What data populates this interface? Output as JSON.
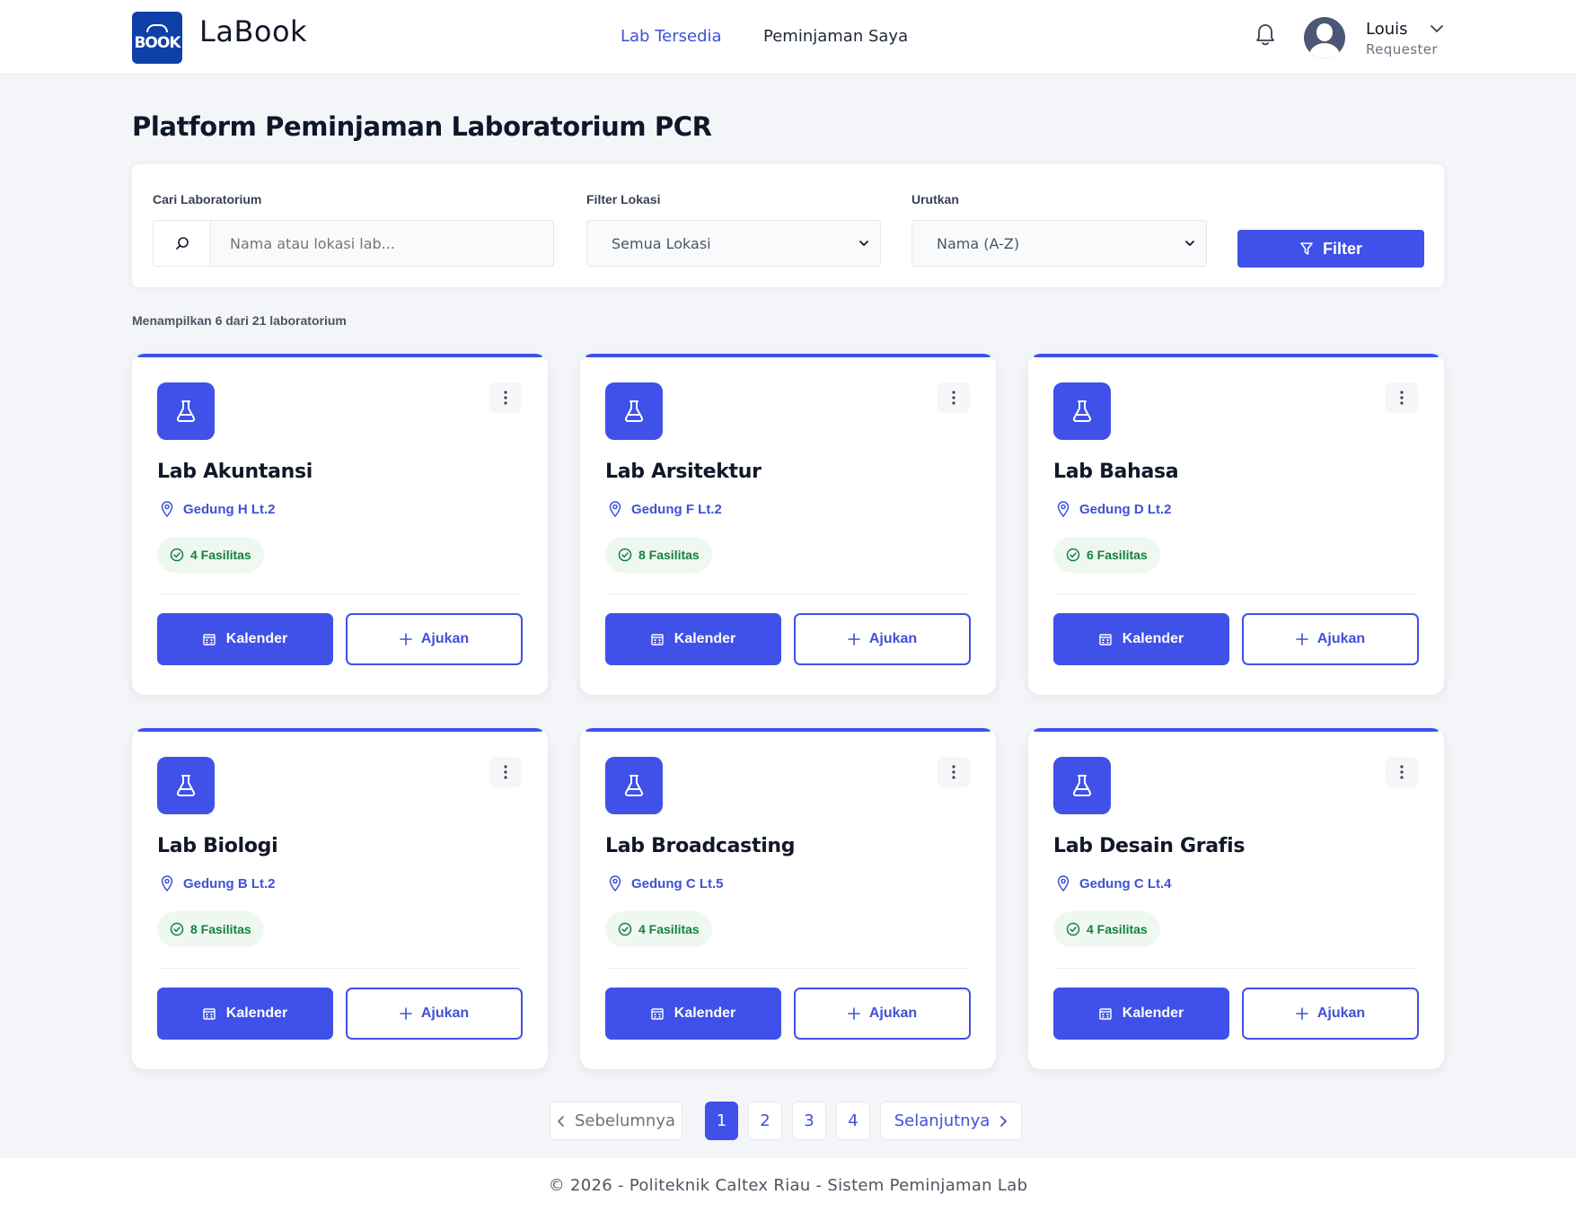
{
  "app": {
    "logo_text": "BOOK",
    "brand": "LaBook"
  },
  "nav": {
    "items": [
      {
        "label": "Lab Tersedia",
        "active": true
      },
      {
        "label": "Peminjaman Saya",
        "active": false
      }
    ]
  },
  "user": {
    "name": "Louis",
    "role": "Requester"
  },
  "page": {
    "title": "Platform Peminjaman Laboratorium PCR"
  },
  "filters": {
    "search_label": "Cari Laboratorium",
    "search_placeholder": "Nama atau lokasi lab...",
    "location_label": "Filter Lokasi",
    "location_value": "Semua Lokasi",
    "sort_label": "Urutkan",
    "sort_value": "Nama (A-Z)",
    "filter_button": "Filter"
  },
  "results": {
    "count_text": "Menampilkan 6 dari 21 laboratorium"
  },
  "labs": [
    {
      "name": "Lab Akuntansi",
      "location": "Gedung H Lt.2",
      "facilities": "4 Fasilitas",
      "calendar": "Kalender",
      "apply": "Ajukan"
    },
    {
      "name": "Lab Arsitektur",
      "location": "Gedung F Lt.2",
      "facilities": "8 Fasilitas",
      "calendar": "Kalender",
      "apply": "Ajukan"
    },
    {
      "name": "Lab Bahasa",
      "location": "Gedung D Lt.2",
      "facilities": "6 Fasilitas",
      "calendar": "Kalender",
      "apply": "Ajukan"
    },
    {
      "name": "Lab Biologi",
      "location": "Gedung B Lt.2",
      "facilities": "8 Fasilitas",
      "calendar": "Kalender",
      "apply": "Ajukan"
    },
    {
      "name": "Lab Broadcasting",
      "location": "Gedung C Lt.5",
      "facilities": "4 Fasilitas",
      "calendar": "Kalender",
      "apply": "Ajukan"
    },
    {
      "name": "Lab Desain Grafis",
      "location": "Gedung C Lt.4",
      "facilities": "4 Fasilitas",
      "calendar": "Kalender",
      "apply": "Ajukan"
    }
  ],
  "pagination": {
    "prev": "Sebelumnya",
    "next": "Selanjutnya",
    "pages": [
      "1",
      "2",
      "3",
      "4"
    ],
    "current": "1"
  },
  "footer": {
    "text": "© 2026 - Politeknik Caltex Riau - Sistem Peminjaman Lab"
  },
  "colors": {
    "primary": "#3f51e8",
    "link": "#3f51d7",
    "success": "#15803d",
    "background": "#f4f5f8"
  },
  "icons": {
    "search": "search-icon",
    "bell": "bell-icon",
    "lab": "flask-icon",
    "location": "map-pin-icon",
    "facilities": "check-circle-icon",
    "calendar": "calendar-icon",
    "apply": "plus-icon",
    "more": "kebab-icon"
  }
}
